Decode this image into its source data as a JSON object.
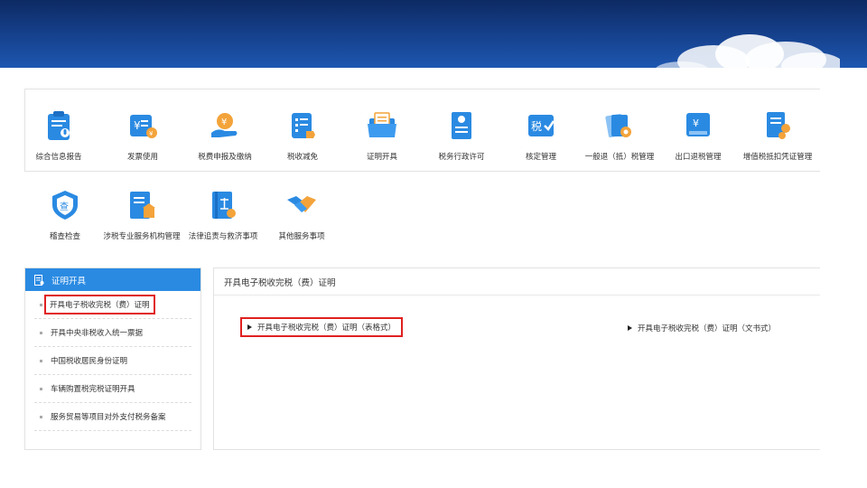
{
  "banner": {},
  "services": [
    {
      "label": "综合信息报告",
      "icon": "clipboard-mic-icon"
    },
    {
      "label": "发票使用",
      "icon": "invoice-yen-icon"
    },
    {
      "label": "税费申报及缴纳",
      "icon": "hand-coin-icon"
    },
    {
      "label": "税收减免",
      "icon": "document-tag-icon"
    },
    {
      "label": "证明开具",
      "icon": "folder-document-icon"
    },
    {
      "label": "税务行政许可",
      "icon": "certificate-icon"
    },
    {
      "label": "核定管理",
      "icon": "tax-check-icon"
    },
    {
      "label": "一般退（抵）税管理",
      "icon": "cards-gear-icon"
    },
    {
      "label": "出口退税管理",
      "icon": "export-yen-icon"
    },
    {
      "label": "增值税抵扣凭证管理",
      "icon": "document-gears-icon"
    }
  ],
  "services_row2": [
    {
      "label": "稽查检查",
      "icon": "shield-inspect-icon"
    },
    {
      "label": "涉税专业服务机构管理",
      "icon": "document-building-icon"
    },
    {
      "label": "法律追责与救济事项",
      "icon": "law-book-icon"
    },
    {
      "label": "其他服务事项",
      "icon": "handshake-icon"
    }
  ],
  "sidebar": {
    "title": "证明开具",
    "icon": "certificate-doc-icon",
    "items": [
      {
        "label": "开具电子税收完税（费）证明",
        "active": true
      },
      {
        "label": "开具中央非税收入统一票据",
        "active": false
      },
      {
        "label": "中国税收居民身份证明",
        "active": false
      },
      {
        "label": "车辆购置税完税证明开具",
        "active": false
      },
      {
        "label": "服务贸易等项目对外支付税务备案",
        "active": false
      }
    ]
  },
  "content": {
    "title": "开具电子税收完税（费）证明",
    "links": [
      {
        "label": "开具电子税收完税（费）证明（表格式）",
        "highlighted": true
      },
      {
        "label": "开具电子税收完税（费）证明（文书式）",
        "highlighted": false
      }
    ]
  },
  "colors": {
    "banner_dark": "#0d2a63",
    "banner_light": "#1d57b0",
    "sidebar_header": "#2a8ae2",
    "highlight_border": "#e02020"
  }
}
